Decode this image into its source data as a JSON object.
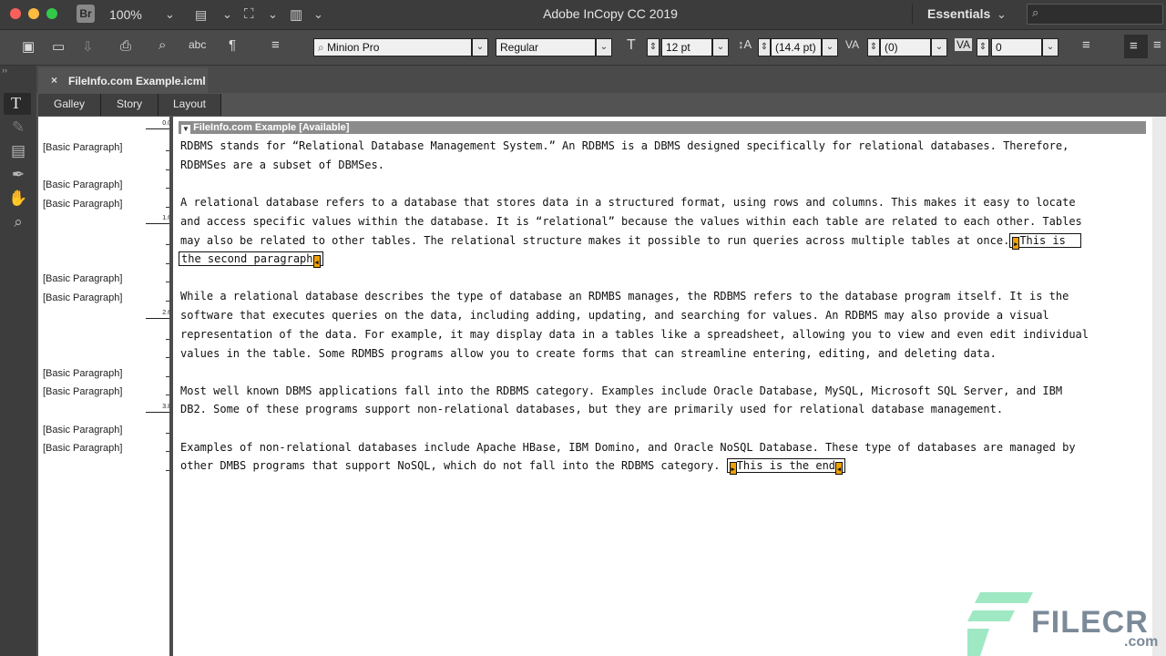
{
  "titlebar": {
    "bridge_label": "Br",
    "zoom": "100%",
    "title": "Adobe InCopy CC 2019",
    "workspace": "Essentials",
    "search_placeholder": ""
  },
  "toolbar": {
    "font_family": "Minion Pro",
    "font_style": "Regular",
    "font_size": "12 pt",
    "leading": "(14.4 pt)",
    "kerning": "(0)",
    "tracking": "0"
  },
  "document": {
    "tab_title": "FileInfo.com Example.icml",
    "view_tabs": [
      "Galley",
      "Story",
      "Layout"
    ],
    "story_title": "FileInfo.com Example [Available]"
  },
  "styles_column": {
    "paragraph_style": "[Basic Paragraph]",
    "depths": [
      "0.0",
      "1.6",
      "2.6",
      "3.8"
    ]
  },
  "content": {
    "lines": [
      "RDBMS stands for “Relational Database Management System.” An RDBMS is a DBMS designed specifically for relational databases. Therefore,",
      "RDBMSes are a subset of DBMSes.",
      "A relational database refers to a database that stores data in a structured format, using rows and columns. This makes it easy to locate",
      "and access specific values within the database. It is “relational” because the values within each table are related to each other. Tables",
      "may also be related to other tables. The relational structure makes it possible to run queries across multiple tables at once.",
      "While a relational database describes the type of database an RDMBS manages, the RDBMS refers to the database program itself. It is the",
      "software that executes queries on the data, including adding, updating, and searching for values. An RDBMS may also provide a visual",
      "representation of the data. For example, it may display data in a tables like a spreadsheet, allowing you to view and even edit individual",
      "values in the table. Some RDMBS programs allow you to create forms that can streamline entering, editing, and deleting data.",
      "Most well known DBMS applications fall into the RDBMS category. Examples include Oracle Database, MySQL, Microsoft SQL Server, and IBM",
      "DB2. Some of these programs support non-relational databases, but they are primarily used for relational database management.",
      "Examples of non-relational databases include Apache HBase, IBM Domino, and Oracle NoSQL Database. These type of databases are managed by",
      "other DMBS programs that support NoSQL, which do not fall into the RDBMS category."
    ],
    "note1_part1": "This is",
    "note1_part2": "the second paragraph",
    "note2": "This is the end"
  },
  "watermark": {
    "brand": "FILECR",
    "suffix": ".com"
  },
  "colors": {
    "note_marker": "#f0a000",
    "watermark_green": "#2ecc71"
  }
}
